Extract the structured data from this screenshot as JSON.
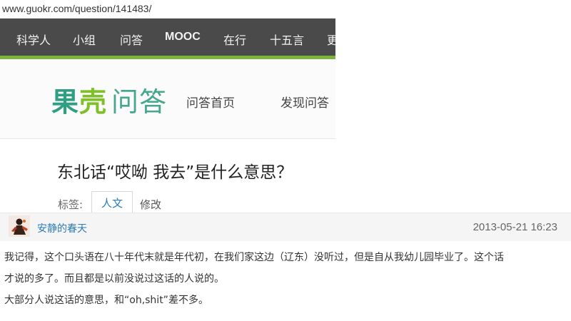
{
  "browser": {
    "url": "www.guokr.com/question/141483/"
  },
  "topnav": {
    "items": [
      {
        "label": "科学人"
      },
      {
        "label": "小组"
      },
      {
        "label": "问答"
      },
      {
        "label": "MOOC"
      },
      {
        "label": "在行"
      },
      {
        "label": "十五言"
      },
      {
        "label": "更"
      }
    ]
  },
  "brand": {
    "logo_part1": "果",
    "logo_part2": "壳",
    "logo_part3": "问答",
    "colors": {
      "teal": "#2f9e82",
      "green": "#7fbf2a",
      "nav_bg": "#4a4a4a",
      "accent_line": "#7bb33c",
      "link_blue": "#2b7bb9"
    }
  },
  "subnav": {
    "home_label": "问答首页",
    "discover_label": "发现问答"
  },
  "question": {
    "title": "东北话“哎呦 我去”是什么意思？",
    "tags_label": "标签:",
    "tag": "人文",
    "edit_label": "修改"
  },
  "answer": {
    "avatar_icon": "user-avatar-icon",
    "author": "安静的春天",
    "time": "2013-05-21 16:23",
    "lines": [
      "我记得，这个口头语在八十年代末就是年代初，在我们家这边（辽东）没听过，但是自从我幼儿园毕业了。这个话",
      "才说的多了。而且都是以前没说过这话的人说的。",
      "大部分人说这话的意思，和“oh,shit”差不多。"
    ]
  }
}
